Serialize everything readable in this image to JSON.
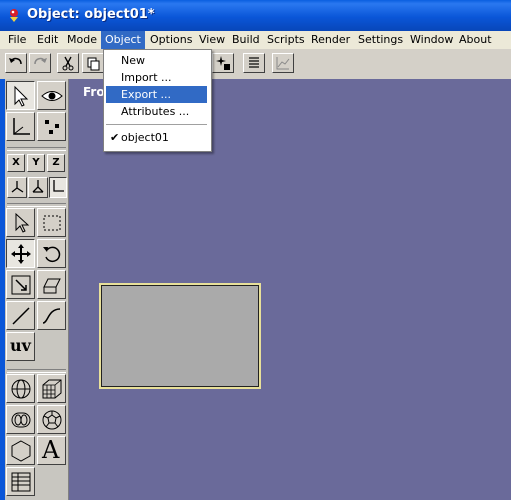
{
  "window": {
    "title": "Object: object01*"
  },
  "menubar": {
    "items": [
      "File",
      "Edit",
      "Mode",
      "Object",
      "Options",
      "View",
      "Build",
      "Scripts",
      "Render",
      "Settings",
      "Window",
      "About"
    ],
    "active": "Object"
  },
  "object_menu": {
    "items": [
      {
        "label": "New"
      },
      {
        "label": "Import ..."
      },
      {
        "label": "Export ...",
        "highlighted": true
      },
      {
        "label": "Attributes ..."
      }
    ],
    "object_entry": {
      "label": "object01",
      "checked": true
    }
  },
  "viewport": {
    "label": "Fro"
  },
  "left_panel": {
    "axis_buttons": [
      "X",
      "Y",
      "Z"
    ],
    "uv_label": "uv",
    "text_tool_label": "A"
  },
  "colors": {
    "titlebar": "#0a56d8",
    "viewport_bg": "#6a6a9a",
    "highlight": "#316ac5",
    "object_fill": "#aaaaaa",
    "object_border": "#e8e09a"
  }
}
